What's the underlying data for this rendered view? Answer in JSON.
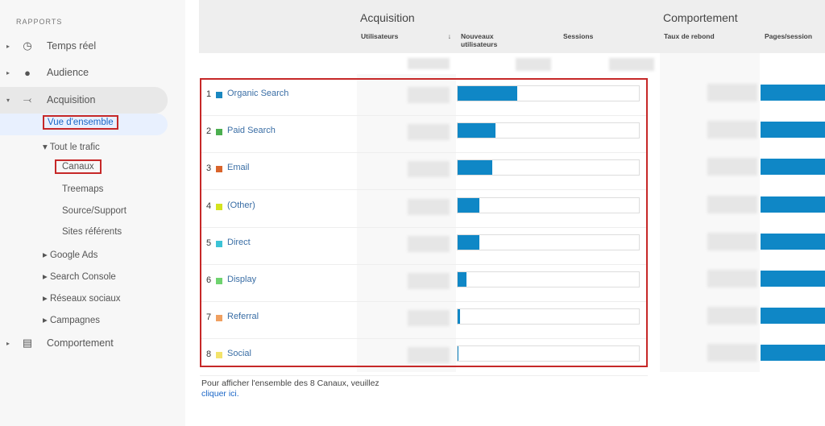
{
  "sidebar": {
    "section": "RAPPORTS",
    "items": [
      {
        "label": "Temps réel",
        "icon": "clock-icon"
      },
      {
        "label": "Audience",
        "icon": "person-icon"
      },
      {
        "label": "Acquisition",
        "icon": "acquisition-icon"
      },
      {
        "label": "Comportement",
        "icon": "behavior-icon"
      }
    ],
    "acquisition_sub": {
      "overview": "Vue d'ensemble",
      "all_traffic": "Tout le trafic",
      "channels": "Canaux",
      "treemaps": "Treemaps",
      "source": "Source/Support",
      "referrals": "Sites référents",
      "google_ads": "Google Ads",
      "search_console": "Search Console",
      "social": "Réseaux sociaux",
      "campaigns": "Campagnes"
    }
  },
  "table": {
    "groups": {
      "acquisition": "Acquisition",
      "behavior": "Comportement"
    },
    "headers": {
      "users": "Utilisateurs",
      "new_users": "Nouveaux utilisateurs",
      "sessions": "Sessions",
      "bounce": "Taux de rebond",
      "pages": "Pages/session"
    },
    "rows": [
      {
        "num": "1",
        "label": "Organic Search",
        "color": "#1a87c0",
        "new_users_pct": 33
      },
      {
        "num": "2",
        "label": "Paid Search",
        "color": "#4caf50",
        "new_users_pct": 21
      },
      {
        "num": "3",
        "label": "Email",
        "color": "#d9642b",
        "new_users_pct": 19
      },
      {
        "num": "4",
        "label": "(Other)",
        "color": "#d4e31f",
        "new_users_pct": 12
      },
      {
        "num": "5",
        "label": "Direct",
        "color": "#3cc3d6",
        "new_users_pct": 12
      },
      {
        "num": "6",
        "label": "Display",
        "color": "#6fd36f",
        "new_users_pct": 5
      },
      {
        "num": "7",
        "label": "Referral",
        "color": "#f0a060",
        "new_users_pct": 1.5
      },
      {
        "num": "8",
        "label": "Social",
        "color": "#f3e36b",
        "new_users_pct": 0.5
      }
    ]
  },
  "footer": {
    "text": "Pour afficher l'ensemble des 8 Canaux, veuillez",
    "link": "cliquer ici."
  }
}
